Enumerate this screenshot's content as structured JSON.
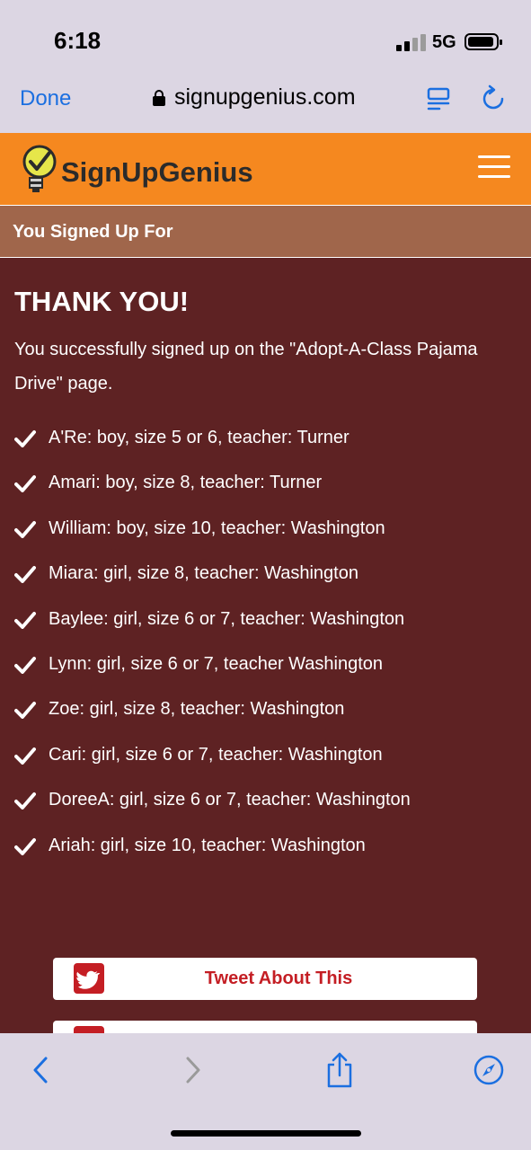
{
  "status_bar": {
    "time": "6:18",
    "network": "5G"
  },
  "browser": {
    "done_label": "Done",
    "url": "signupgenius.com"
  },
  "site": {
    "logo_text": "SignUpGenius"
  },
  "subheader": {
    "title": "You Signed Up For"
  },
  "content": {
    "heading": "THANK YOU!",
    "message": "You successfully signed up on the \"Adopt-A-Class Pajama Drive\" page.",
    "items": [
      "A'Re: boy, size 5 or 6, teacher: Turner",
      "Amari: boy, size 8, teacher: Turner",
      "William: boy, size 10, teacher: Washington",
      "Miara: girl, size 8, teacher: Washington",
      "Baylee: girl, size 6 or 7, teacher: Washington",
      "Lynn: girl, size 6 or 7, teacher Washington",
      "Zoe: girl, size 8, teacher: Washington",
      "Cari: girl, size 6 or 7, teacher: Washington",
      "DoreeA: girl, size 6 or 7, teacher: Washington",
      "Ariah: girl, size 10, teacher: Washington"
    ]
  },
  "share": {
    "tweet_label": "Tweet About This"
  },
  "colors": {
    "accent": "#f5881f",
    "background": "#5e2223",
    "subheader": "#a0664b",
    "link": "#1b6fe0",
    "tweet": "#c41e24"
  },
  "icons": [
    "lock-icon",
    "reader-icon",
    "reload-icon",
    "menu-icon",
    "check-icon",
    "twitter-icon",
    "facebook-icon",
    "back-icon",
    "forward-icon",
    "share-icon",
    "compass-icon"
  ]
}
